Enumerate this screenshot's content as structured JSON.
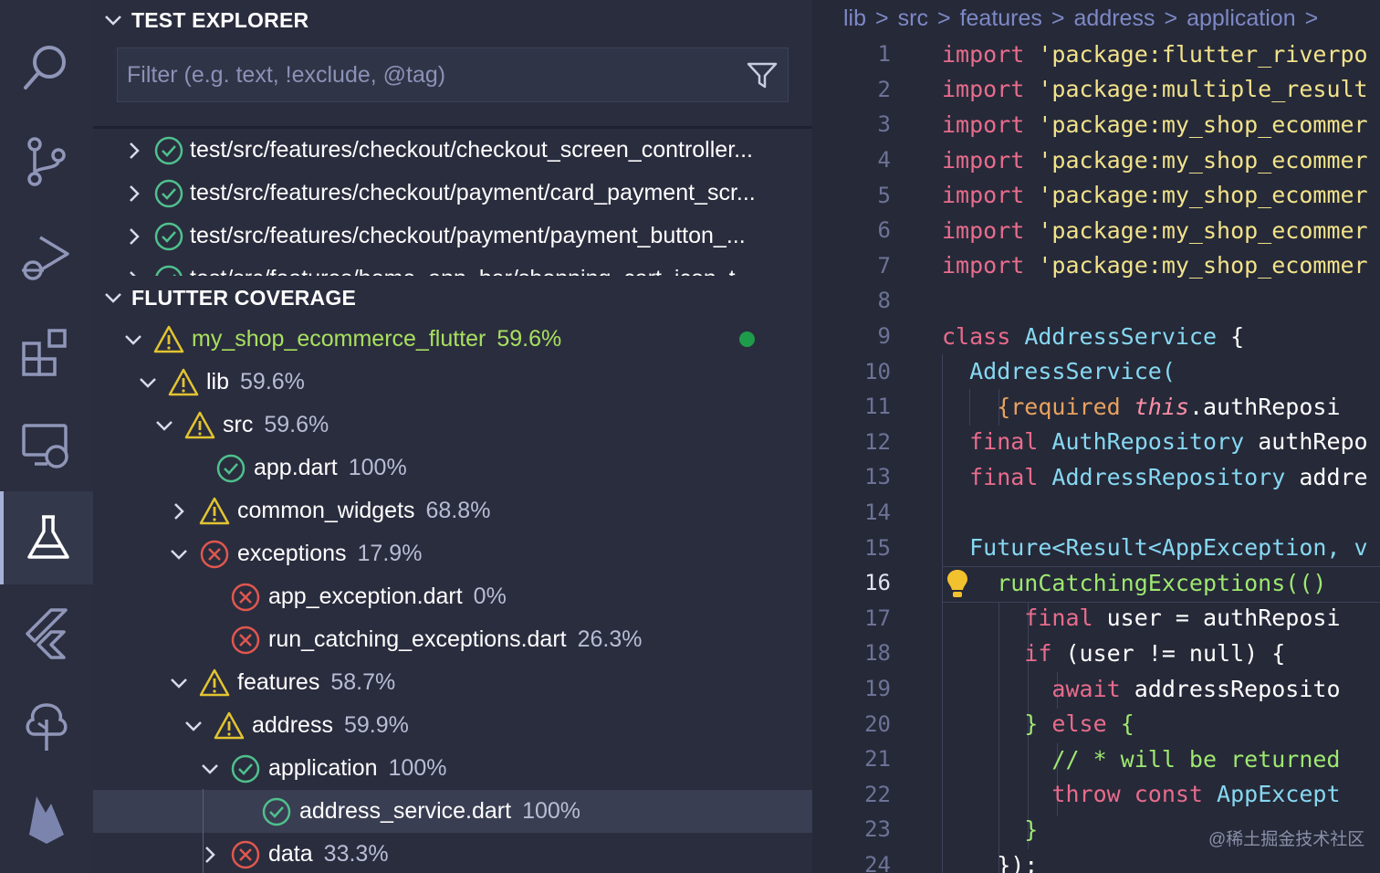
{
  "activity_bar": {
    "items": [
      {
        "icon": "search-icon"
      },
      {
        "icon": "source-control-icon"
      },
      {
        "icon": "run-debug-icon"
      },
      {
        "icon": "extensions-icon"
      },
      {
        "icon": "remote-explorer-icon"
      },
      {
        "icon": "testing-flask-icon",
        "active": true
      },
      {
        "icon": "flutter-icon"
      },
      {
        "icon": "tree-icon"
      },
      {
        "icon": "firebase-icon"
      }
    ]
  },
  "test_explorer": {
    "title": "TEST EXPLORER",
    "filter_placeholder": "Filter (e.g. text, !exclude, @tag)",
    "items": [
      {
        "label": "test/src/features/checkout/checkout_screen_controller..."
      },
      {
        "label": "test/src/features/checkout/payment/card_payment_scr..."
      },
      {
        "label": "test/src/features/checkout/payment/payment_button_..."
      },
      {
        "label": "test/src/features/home_app_bar/shopping_cart_icon_t..."
      }
    ]
  },
  "coverage": {
    "title": "FLUTTER COVERAGE",
    "rows": [
      {
        "name": "my_shop_ecommerce_flutter",
        "pct": "59.6%"
      },
      {
        "name": "lib",
        "pct": "59.6%"
      },
      {
        "name": "src",
        "pct": "59.6%"
      },
      {
        "name": "app.dart",
        "pct": "100%"
      },
      {
        "name": "common_widgets",
        "pct": "68.8%"
      },
      {
        "name": "exceptions",
        "pct": "17.9%"
      },
      {
        "name": "app_exception.dart",
        "pct": "0%"
      },
      {
        "name": "run_catching_exceptions.dart",
        "pct": "26.3%"
      },
      {
        "name": "features",
        "pct": "58.7%"
      },
      {
        "name": "address",
        "pct": "59.9%"
      },
      {
        "name": "application",
        "pct": "100%"
      },
      {
        "name": "address_service.dart",
        "pct": "100%"
      },
      {
        "name": "data",
        "pct": "33.3%"
      }
    ]
  },
  "editor": {
    "breadcrumb": [
      "lib",
      "src",
      "features",
      "address",
      "application"
    ],
    "current_line": "16",
    "lines": [
      {
        "n": "1",
        "t1": "import",
        "t2": " 'package:flutter_riverpo"
      },
      {
        "n": "2",
        "t1": "import",
        "t2": " 'package:multiple_result"
      },
      {
        "n": "3",
        "t1": "import",
        "t2": " 'package:my_shop_ecommer"
      },
      {
        "n": "4",
        "t1": "import",
        "t2": " 'package:my_shop_ecommer"
      },
      {
        "n": "5",
        "t1": "import",
        "t2": " 'package:my_shop_ecommer"
      },
      {
        "n": "6",
        "t1": "import",
        "t2": " 'package:my_shop_ecommer"
      },
      {
        "n": "7",
        "t1": "import",
        "t2": " 'package:my_shop_ecommer"
      },
      {
        "n": "8"
      },
      {
        "n": "9",
        "t1": "class",
        "t2": " AddressService",
        "t3": " {"
      },
      {
        "n": "10",
        "t1": "  AddressService("
      },
      {
        "n": "11",
        "t1": "    {required ",
        "t2": "this",
        "t3": ".authReposi"
      },
      {
        "n": "12",
        "t1": "  final",
        "t2": " AuthRepository",
        "t3": " authRepo"
      },
      {
        "n": "13",
        "t1": "  final",
        "t2": " AddressRepository",
        "t3": " addre"
      },
      {
        "n": "14"
      },
      {
        "n": "15",
        "t1": "  Future<Result<AppException, v"
      },
      {
        "n": "16",
        "t1": "    runCatchingExceptions(()"
      },
      {
        "n": "17",
        "t1": "      final",
        "t2": " user = authReposi"
      },
      {
        "n": "18",
        "t1": "      if",
        "t2": " (user != null) {"
      },
      {
        "n": "19",
        "t1": "        await",
        "t2": " addressReposito"
      },
      {
        "n": "20",
        "t1": "      } ",
        "t2": "else",
        "t3": " {"
      },
      {
        "n": "21",
        "t1": "        // * will be returned"
      },
      {
        "n": "22",
        "t1": "        throw const",
        "t2": " AppExcept"
      },
      {
        "n": "23",
        "t1": "      }"
      },
      {
        "n": "24",
        "t1": "    });"
      }
    ],
    "watermark": "@稀土掘金技术社区"
  },
  "colors": {
    "background": "#262938",
    "panel": "#2a2d3e",
    "pass": "#4fc08d",
    "warn": "#e2c431",
    "fail": "#e0574f",
    "root_highlight": "#a8e05f"
  }
}
